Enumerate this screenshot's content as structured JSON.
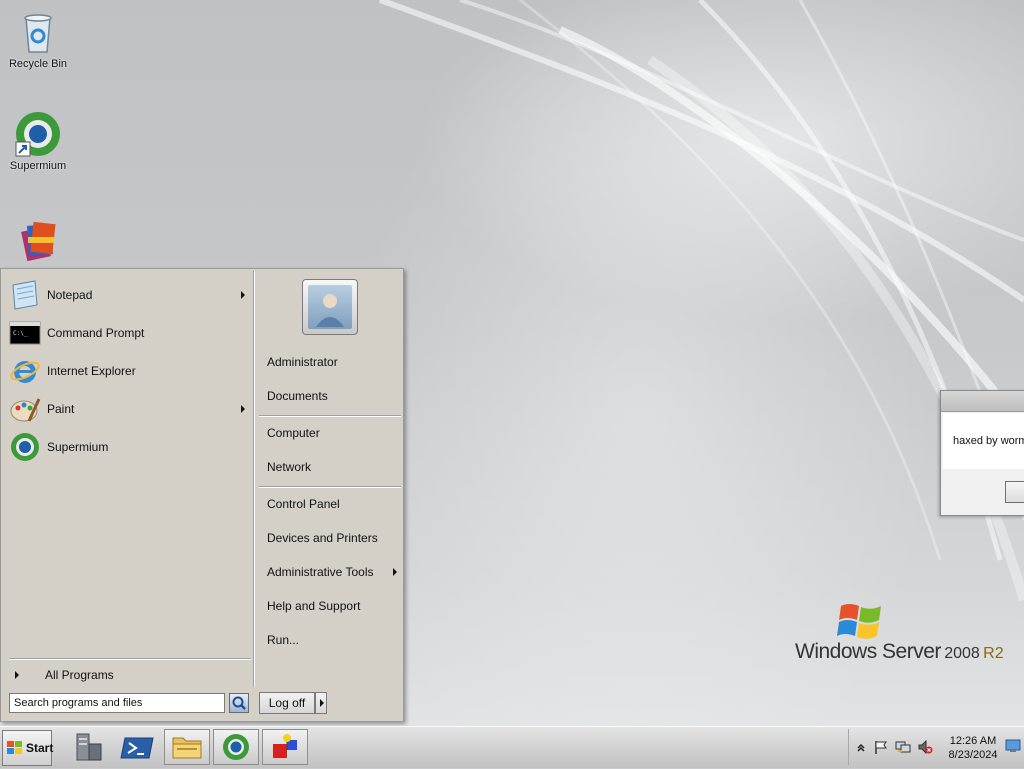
{
  "desktop": {
    "icons": [
      {
        "label": "Recycle Bin",
        "icon": "recycle-bin-icon"
      },
      {
        "label": "Supermium",
        "icon": "supermium-icon"
      },
      {
        "label": "",
        "icon": "winrar-icon"
      }
    ]
  },
  "start_menu": {
    "programs": [
      {
        "label": "Notepad",
        "icon": "notepad-icon",
        "has_submenu": true
      },
      {
        "label": "Command Prompt",
        "icon": "command-prompt-icon",
        "has_submenu": false
      },
      {
        "label": "Internet Explorer",
        "icon": "internet-explorer-icon",
        "has_submenu": false
      },
      {
        "label": "Paint",
        "icon": "paint-icon",
        "has_submenu": true
      },
      {
        "label": "Supermium",
        "icon": "supermium-icon",
        "has_submenu": false
      }
    ],
    "all_programs": "All Programs",
    "right_items": [
      {
        "label": "Administrator"
      },
      {
        "label": "Documents"
      },
      {
        "label": "Computer"
      },
      {
        "label": "Network"
      },
      {
        "label": "Control Panel"
      },
      {
        "label": "Devices and Printers"
      },
      {
        "label": "Administrative Tools",
        "has_submenu": true
      },
      {
        "label": "Help and Support"
      },
      {
        "label": "Run..."
      }
    ],
    "search_placeholder": "Search programs and files",
    "logoff_label": "Log off"
  },
  "dialog": {
    "message": "haxed by worm"
  },
  "branding": {
    "product": "Windows Server",
    "version": "2008",
    "edition": "R2"
  },
  "taskbar": {
    "start_label": "Start",
    "pinned": [
      {
        "icon": "server-manager-icon"
      },
      {
        "icon": "powershell-icon"
      },
      {
        "icon": "windows-explorer-icon"
      },
      {
        "icon": "supermium-icon"
      },
      {
        "icon": "shapes-app-icon"
      }
    ],
    "clock_time": "12:26 AM",
    "clock_date": "8/23/2024"
  },
  "colors": {
    "menu_bg": "#d4d0c8",
    "taskbar_bg": "#d2d2d2",
    "accent_blue": "#2a6fc0"
  }
}
